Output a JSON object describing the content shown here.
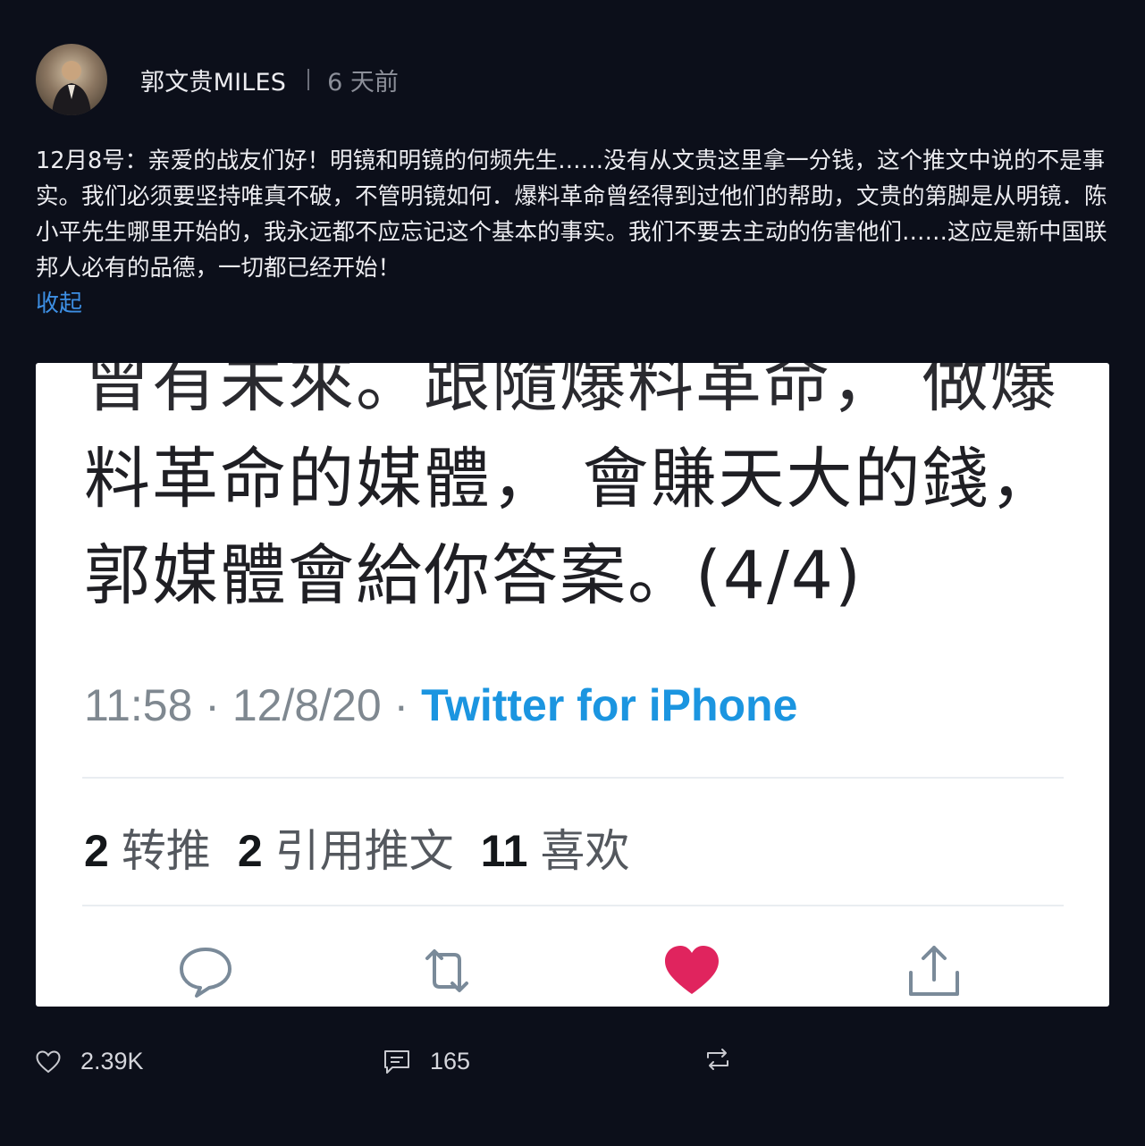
{
  "header": {
    "author": "郭文贵MILES",
    "time": "6 天前"
  },
  "post": {
    "text": "12月8号：亲爱的战友们好！明镜和明镜的何频先生……没有从文贵这里拿一分钱，这个推文中说的不是事实。我们必须要坚持唯真不破，不管明镜如何．爆料革命曾经得到过他们的帮助，文贵的第脚是从明镜．陈小平先生哪里开始的，我永远都不应忘记这个基本的事实。我们不要去主动的伤害他们……这应是新中国联邦人必有的品德，一切都已经开始！",
    "collapse_label": "收起"
  },
  "image": {
    "line1": "曾有未來。跟隨爆料革命， 做爆",
    "line2": "料革命的媒體， 會賺天大的錢，",
    "line3": "郭媒體會給你答案。(4/4)",
    "meta_time": "11:58 · 12/8/20 · ",
    "meta_source": "Twitter for iPhone",
    "retweets_count": "2",
    "retweets_label": "转推",
    "quotes_count": "2",
    "quotes_label": "引用推文",
    "likes_count": "11",
    "likes_label": "喜欢",
    "like_color": "#e0245e",
    "icons": [
      "reply-icon",
      "retweet-icon",
      "heart-icon",
      "share-icon"
    ]
  },
  "footer": {
    "likes": "2.39K",
    "comments": "165",
    "icons": [
      "heart-outline-icon",
      "comment-icon",
      "repost-icon"
    ]
  }
}
